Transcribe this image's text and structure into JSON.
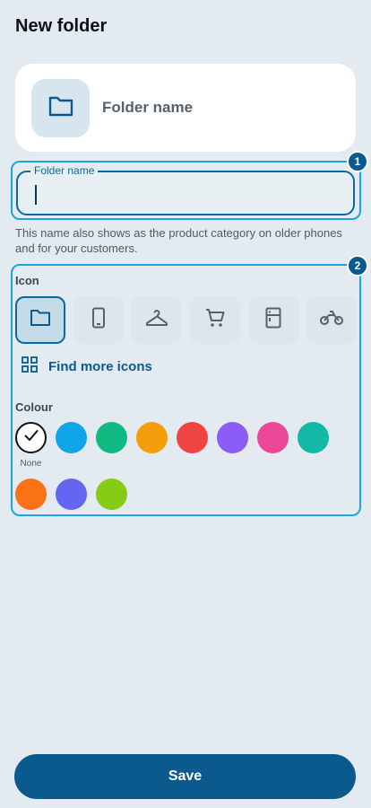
{
  "header": {
    "title": "New folder"
  },
  "preview": {
    "name": "Folder name",
    "icon": "folder-icon"
  },
  "folder_name_field": {
    "label": "Folder name",
    "value": ""
  },
  "helper_text": "This name also shows as the product category on older phones and for your customers.",
  "markers": [
    "1",
    "2"
  ],
  "icon_section": {
    "label": "Icon",
    "options": [
      "folder-icon",
      "phone-icon",
      "hanger-icon",
      "cart-icon",
      "fridge-icon",
      "motorbike-icon"
    ],
    "selected": "folder-icon",
    "find_more_label": "Find more icons"
  },
  "colour_section": {
    "label": "Colour",
    "none_label": "None",
    "selected": "None",
    "swatches": [
      "#0ea5e9",
      "#10b981",
      "#f59e0b",
      "#ef4444",
      "#8b5cf6",
      "#ec4899",
      "#14b8a6",
      "#f97316",
      "#6366f1",
      "#84cc16"
    ]
  },
  "save_label": "Save",
  "colors": {
    "accent": "#0b5a8d",
    "highlight": "#1ba6dc",
    "background": "#e3ebf1"
  }
}
